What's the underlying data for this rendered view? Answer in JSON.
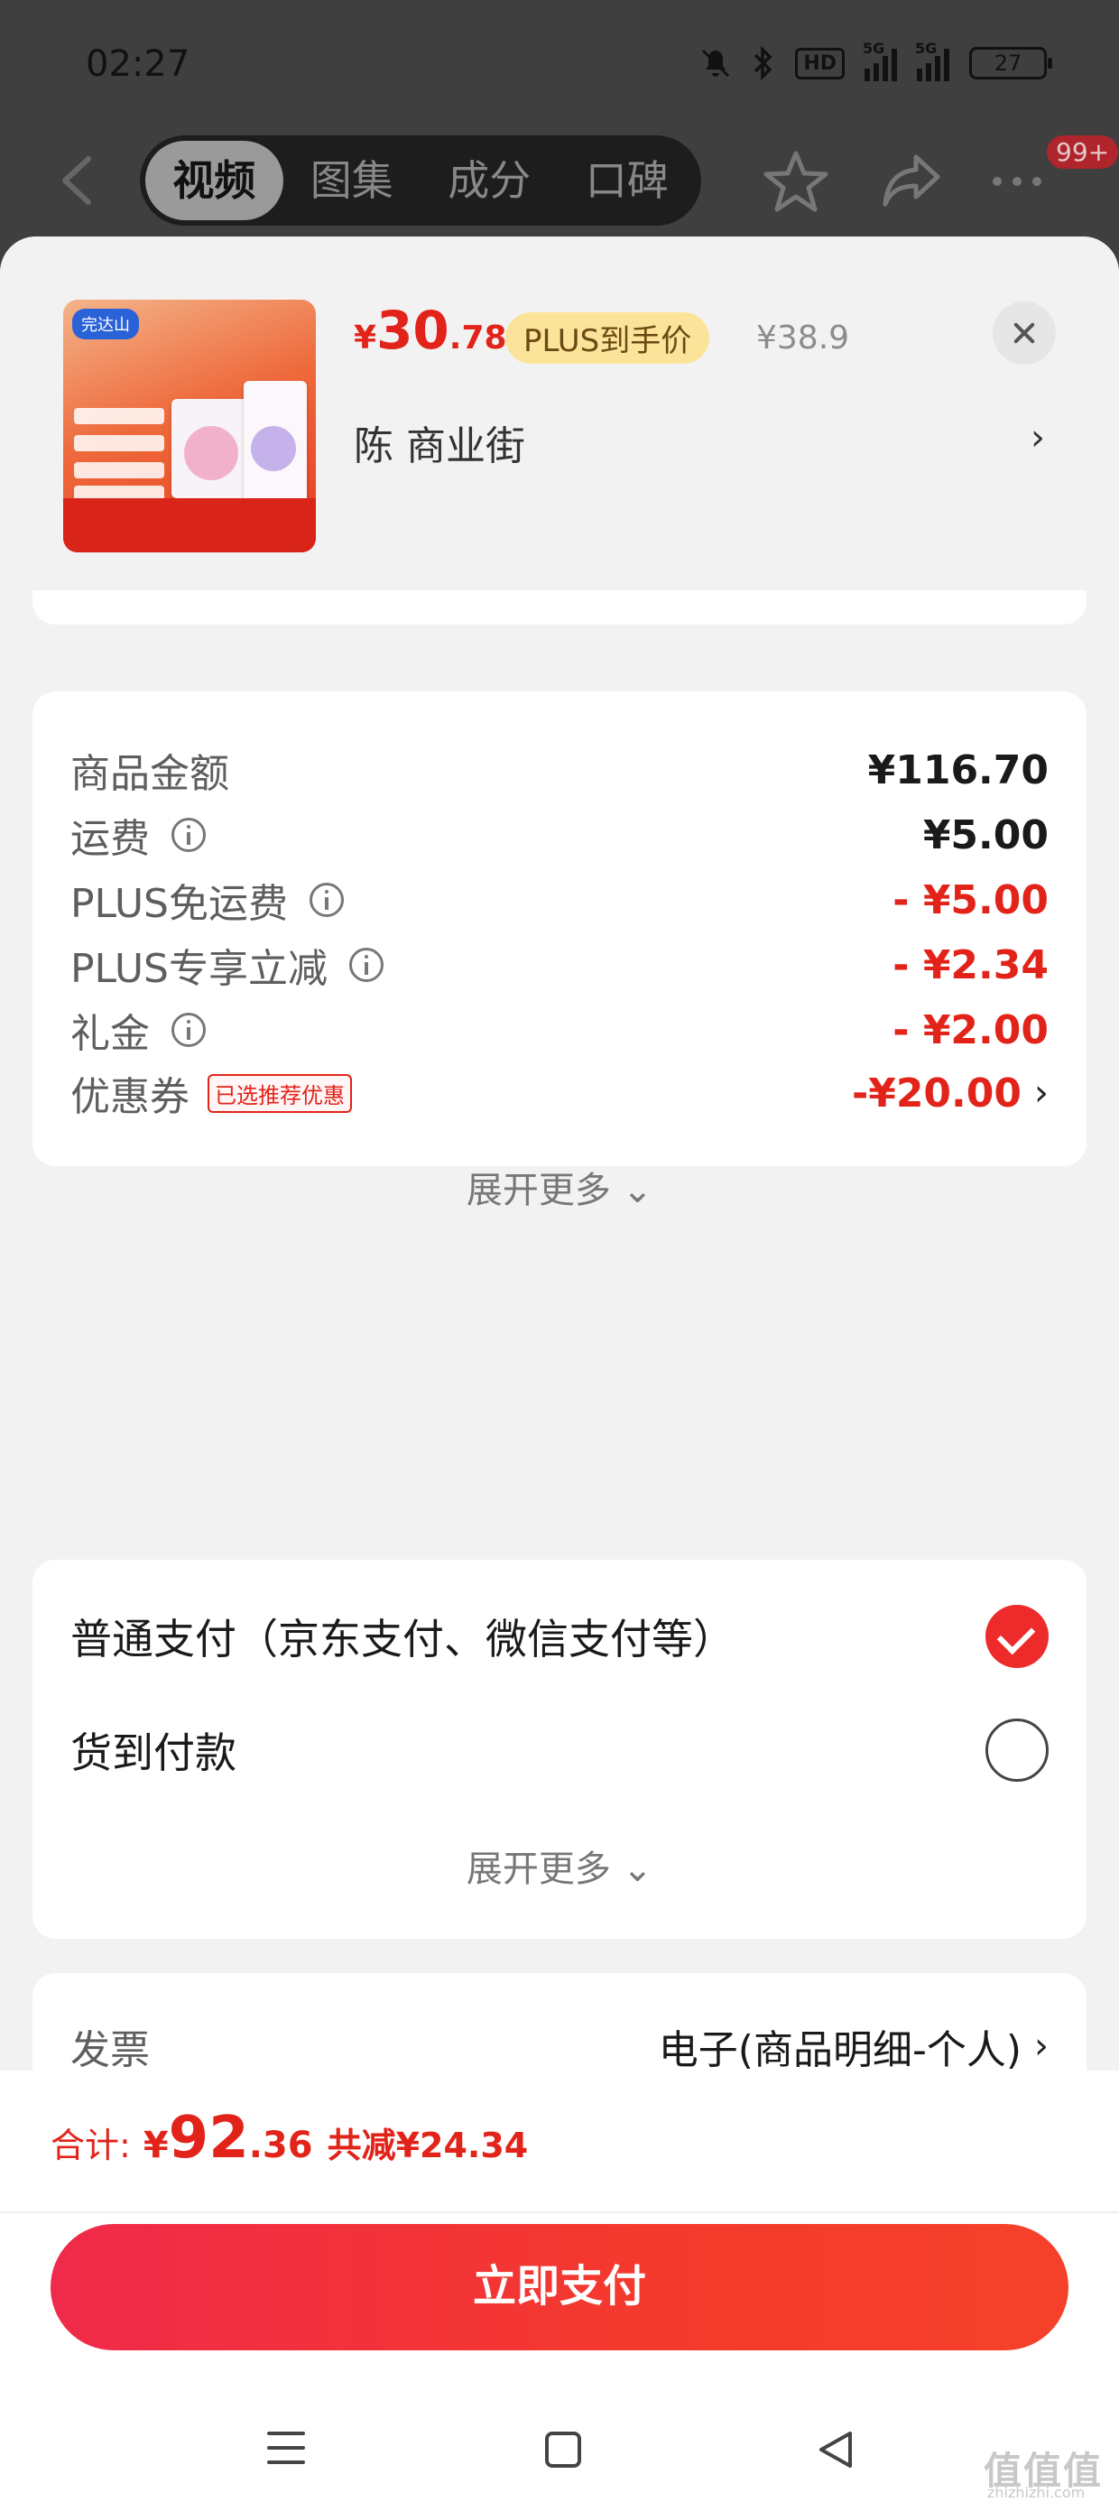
{
  "status_bar": {
    "time": "02:27",
    "battery": "27",
    "icons": [
      "mute-icon",
      "bluetooth-icon",
      "hd-icon",
      "signal-5g-icon",
      "signal-5g-icon",
      "battery-icon"
    ],
    "hd_label": "HD",
    "net1": "5G",
    "net2": "5G"
  },
  "top_nav": {
    "tabs": [
      "视频",
      "图集",
      "成分",
      "口碑"
    ],
    "active_tab": "视频",
    "badge": "99+"
  },
  "product": {
    "price_yen": "¥",
    "price_int": "30",
    "price_dec": ".78",
    "plus_tag": "PLUS到手价",
    "original_price": "¥38.9",
    "store": "陈  商业街",
    "brand_label": "完达山"
  },
  "fees": {
    "rows": [
      {
        "label": "商品金额",
        "value": "¥116.70",
        "info": false,
        "red": false
      },
      {
        "label": "运费",
        "value": "¥5.00",
        "info": true,
        "red": false
      },
      {
        "label": "PLUS免运费",
        "value": "- ¥5.00",
        "info": true,
        "red": true
      },
      {
        "label": "PLUS专享立减",
        "value": "- ¥2.34",
        "info": true,
        "red": true
      },
      {
        "label": "礼金",
        "value": "- ¥2.00",
        "info": true,
        "red": true
      }
    ],
    "coupon": {
      "label": "优惠券",
      "tag": "已选推荐优惠",
      "value": "-¥20.00"
    },
    "expand_more": "展开更多"
  },
  "payment": {
    "options": [
      {
        "label": "普通支付（京东支付、微信支付等）",
        "selected": true
      },
      {
        "label": "货到付款",
        "selected": false
      }
    ],
    "expand_more": "展开更多"
  },
  "invoice": {
    "label": "发票",
    "value": "电子(商品明细-个人)"
  },
  "footer": {
    "total_label": "合计:",
    "total_yen": "¥",
    "total_int": "92",
    "total_dec": ".36",
    "saved": "共减¥24.34",
    "pay_button": "立即支付"
  },
  "watermark": {
    "main": "值值值",
    "sub": "zhizhizhi.com"
  },
  "colors": {
    "accent": "#e2231a",
    "plus_tag_bg": "#fbe49a",
    "sheet_bg": "#f2f2f2"
  }
}
